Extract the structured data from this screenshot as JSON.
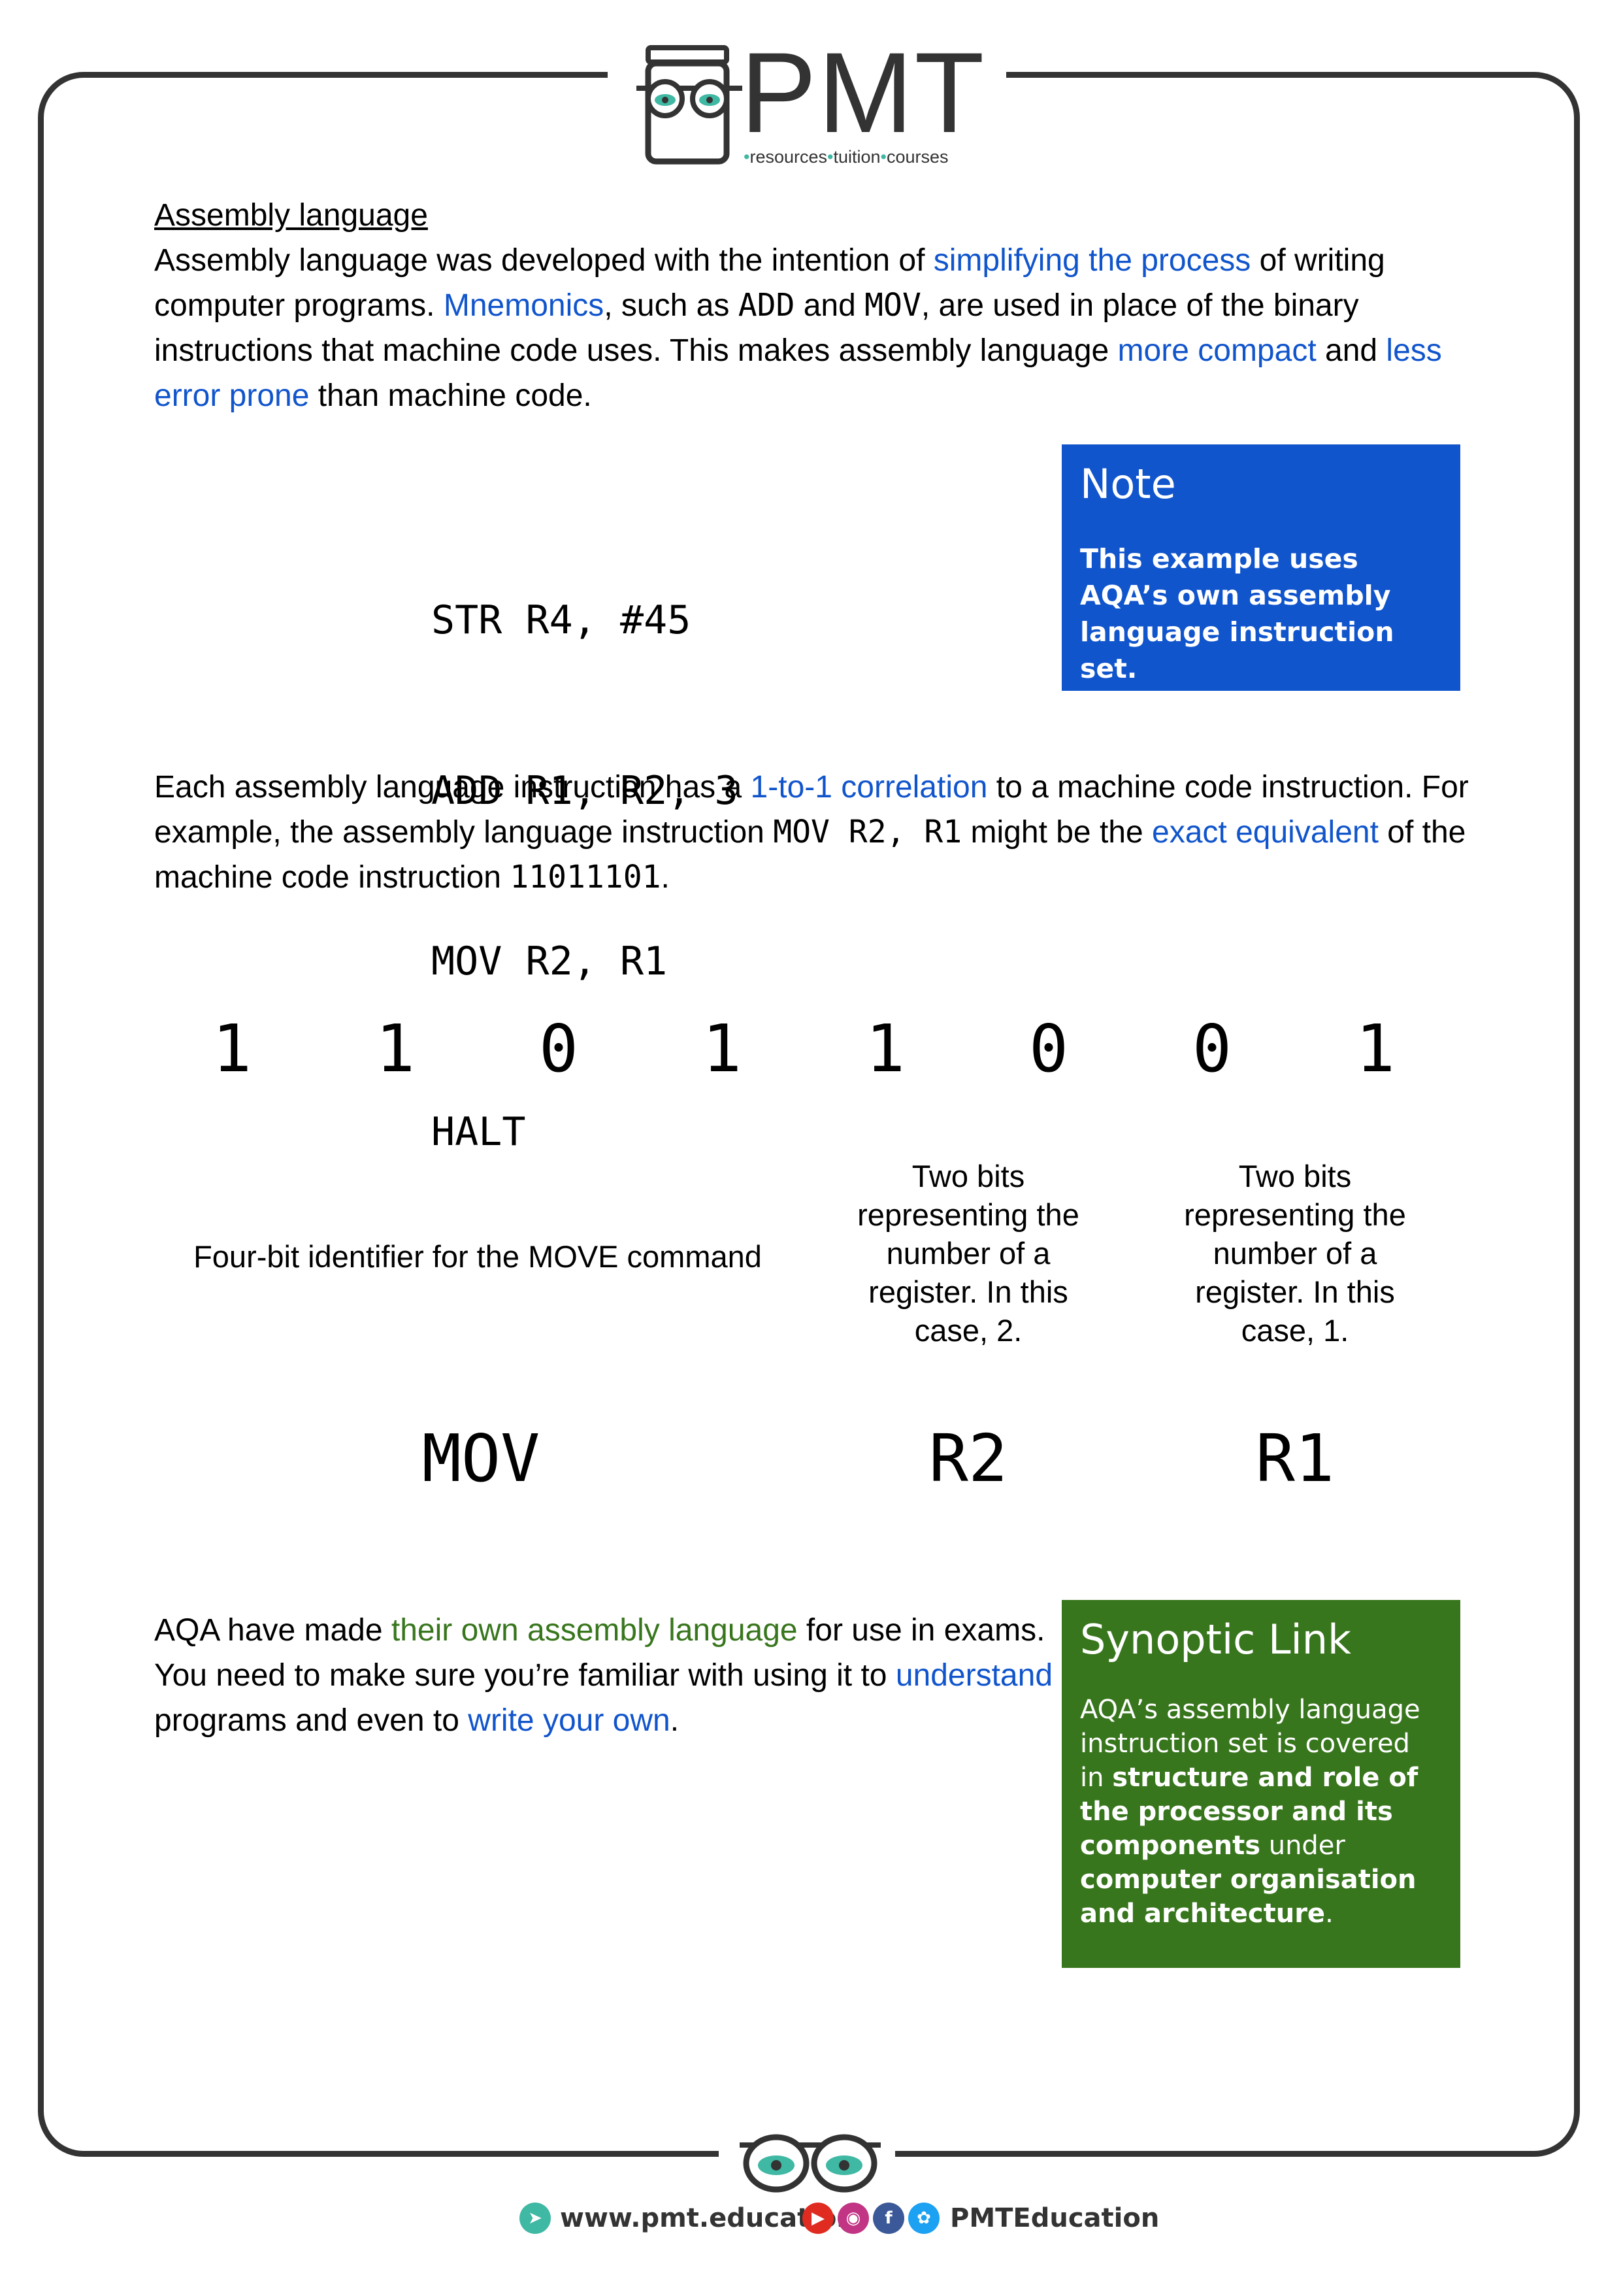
{
  "logo": {
    "name": "PMT",
    "tag_parts": [
      "resources",
      "tuition",
      "courses"
    ],
    "tag_separator": "•"
  },
  "heading": "Assembly language",
  "intro": {
    "t1": "Assembly language was developed with the intention of ",
    "h1": "simplifying the process",
    "t2": " of writing computer programs. ",
    "h2": "Mnemonics",
    "t3": ", such as ",
    "c1": "ADD",
    "t4": " and ",
    "c2": "MOV",
    "t5": ", are used in place of the binary instructions that machine code uses. This makes assembly language ",
    "h3": "more compact",
    "t6": " and ",
    "h4": "less error prone",
    "t7": " than machine code."
  },
  "code_lines": [
    "STR R4, #45",
    "ADD R1, R2, 3",
    "MOV R2, R1",
    "HALT"
  ],
  "note": {
    "title": "Note",
    "body": "This example uses AQA’s own assembly language instruction set."
  },
  "correlation": {
    "t1": "Each assembly language instruction has a ",
    "h1": "1-to-1 correlation",
    "t2": " to a machine code instruction. For example, the assembly language instruction ",
    "c1": "MOV R2, R1",
    "t3": " might be the ",
    "h2": "exact equivalent",
    "t4": " of the machine code instruction ",
    "c2": "11011101",
    "t5": "."
  },
  "bits": [
    "1",
    "1",
    "0",
    "1",
    "1",
    "0",
    "0",
    "1"
  ],
  "captions": {
    "opcode": "Four-bit identifier for the MOVE command",
    "reg_a": "Two bits representing the number of a register. In this case, 2.",
    "reg_b": "Two bits representing the number of a register. In this case, 1."
  },
  "fields": [
    "MOV",
    "R2",
    "R1"
  ],
  "aqa": {
    "t1": "AQA have made ",
    "h1": "their own assembly language",
    "t2": " for use in exams. You need to make sure you’re familiar with using it to ",
    "h2": "understand",
    "t3": " programs and even to ",
    "h3": "write your own",
    "t4": "."
  },
  "synoptic": {
    "title": "Synoptic Link",
    "t1": "AQA’s assembly language instruction set is covered in ",
    "b1": "structure and role of the processor and its components",
    "t2": " under ",
    "b2": "computer organisation and architecture",
    "t3": "."
  },
  "footer": {
    "website": "www.pmt.education",
    "handle": "PMTEducation"
  },
  "colors": {
    "highlight_blue": "#1155cc",
    "highlight_green": "#38761d",
    "frame": "#333333",
    "teal_accent": "#3fb8a4"
  }
}
